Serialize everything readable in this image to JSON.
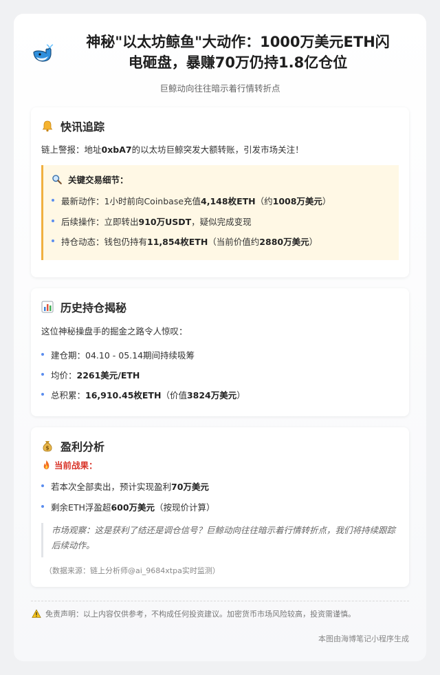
{
  "header": {
    "title_line1": "神秘\"以太坊鲸鱼\"大动作：1000万美元ETH闪",
    "title_line2": "电砸盘，暴赚70万仍持1.8亿仓位",
    "subtitle": "巨鲸动向往往暗示着行情转折点"
  },
  "news": {
    "icon": "bell-icon",
    "title": "快讯追踪",
    "alert_prefix": "链上警报：地址",
    "alert_address": "0xbA7",
    "alert_suffix": "的以太坊巨鲸突发大额转账，引发市场关注！",
    "details_icon": "magnifier-icon",
    "details_title": "关键交易细节：",
    "details": [
      {
        "a": "最新动作：1小时前向Coinbase充值",
        "b": "4,148枚ETH",
        "c": "（约",
        "d": "1008万美元",
        "e": "）"
      },
      {
        "a": "后续操作：立即转出",
        "b": "910万USDT",
        "c": "，疑似完成变现",
        "d": "",
        "e": ""
      },
      {
        "a": "持仓动态：钱包仍持有",
        "b": "11,854枚ETH",
        "c": "（当前价值约",
        "d": "2880万美元",
        "e": "）"
      }
    ]
  },
  "history": {
    "icon": "bar-chart-icon",
    "title": "历史持仓揭秘",
    "intro": "这位神秘操盘手的掘金之路令人惊叹：",
    "items": [
      {
        "a": "建仓期：04.10 - 05.14期间持续吸筹",
        "b": "",
        "c": "",
        "d": "",
        "e": ""
      },
      {
        "a": "均价：",
        "b": "2261美元/ETH",
        "c": "",
        "d": "",
        "e": ""
      },
      {
        "a": "总积累：",
        "b": "16,910.45枚ETH",
        "c": "（价值",
        "d": "3824万美元",
        "e": "）"
      }
    ]
  },
  "profit": {
    "icon": "money-bag-icon",
    "title": "盈利分析",
    "result_icon": "fire-icon",
    "result_label": "当前战果：",
    "items": [
      {
        "a": "若本次全部卖出，预计实现盈利",
        "b": "70万美元",
        "c": "",
        "d": "",
        "e": ""
      },
      {
        "a": "剩余ETH浮盈超",
        "b": "600万美元",
        "c": "（按现价计算）",
        "d": "",
        "e": ""
      }
    ],
    "quote": "市场观察：这是获利了结还是调仓信号？巨鲸动向往往暗示着行情转折点，我们将持续跟踪后续动作。",
    "source": "（数据来源：链上分析师@ai_9684xtpa实时监测）"
  },
  "disclaimer": {
    "icon": "warning-icon",
    "text": "免责声明：以上内容仅供参考，不构成任何投资建议。加密货币市场风险较高，投资需谨慎。"
  },
  "footer": "本图由海博笔记小程序生成",
  "colors": {
    "accent_blue": "#5b8def",
    "callout_bg": "#fff8e5",
    "callout_border": "#f0b040",
    "result_red": "#d9362b"
  }
}
